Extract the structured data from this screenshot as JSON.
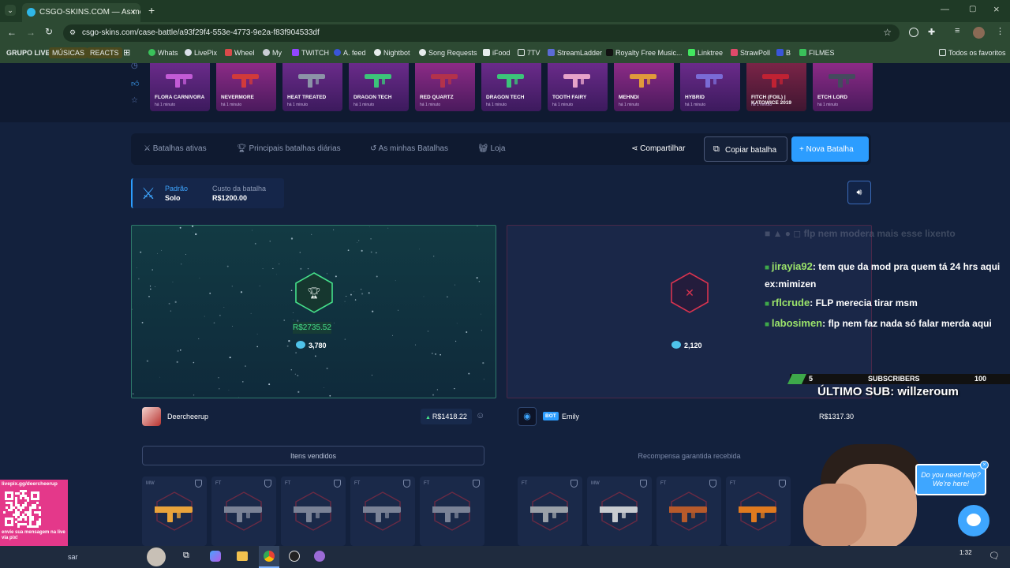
{
  "browser": {
    "tab_title": "CSGO-SKINS.COM — As melho",
    "url": "csgo-skins.com/case-battle/a93f29f4-553e-4773-9e2a-f83f904533df",
    "bookmarks": [
      "GRUPO LIVE",
      "MÚSICAS",
      "REACTS",
      "Whats",
      "LivePix",
      "Wheel",
      "My",
      "TWITCH",
      "A. feed",
      "Nightbot",
      "Song Requests",
      "iFood",
      "7TV",
      "StreamLadder",
      "Royalty Free Music...",
      "Linktree",
      "StrawPoll",
      "B",
      "FILMES"
    ],
    "all_favorites": "Todos os favoritos"
  },
  "drops": [
    {
      "name": "FLORA CARNIVORA",
      "time": "há 1 minuto",
      "color": "#c25bd6"
    },
    {
      "name": "NEVERMORE",
      "time": "há 1 minuto",
      "color": "#d13a3a"
    },
    {
      "name": "HEAT TREATED",
      "time": "há 1 minuto",
      "color": "#8c93a8"
    },
    {
      "name": "DRAGON TECH",
      "time": "há 1 minuto",
      "color": "#3cc47a"
    },
    {
      "name": "RED QUARTZ",
      "time": "há 1 minuto",
      "color": "#b3324b"
    },
    {
      "name": "DRAGON TECH",
      "time": "há 1 minuto",
      "color": "#3cc47a"
    },
    {
      "name": "TOOTH FAIRY",
      "time": "há 1 minuto",
      "color": "#e6a3c9"
    },
    {
      "name": "MEHNDI",
      "time": "há 1 minuto",
      "color": "#e09a3b"
    },
    {
      "name": "HYBRID",
      "time": "há 1 minuto",
      "color": "#7a6bd6"
    },
    {
      "name": "FITCH (FOIL) | KATOWICE 2019",
      "time": "há 1 minuto",
      "color": "#c02233"
    },
    {
      "name": "ETCH LORD",
      "time": "há 1 minuto",
      "color": "#444b5e"
    }
  ],
  "nav": {
    "active_battles": "Batalhas ativas",
    "top_daily": "Principais batalhas diárias",
    "my_battles": "As minhas Batalhas",
    "shop": "Loja",
    "share": "Compartilhar",
    "copy_battle": "Copiar batalha",
    "new_battle": "+ Nova Batalha"
  },
  "battle": {
    "mode": "Padrão",
    "mode_sub": "Solo",
    "cost_label": "Custo da batalha",
    "cost": "R$1200.00"
  },
  "left_arena": {
    "win_value": "R$2735.52",
    "coins": "3,780"
  },
  "right_arena": {
    "coins": "2,120"
  },
  "players": [
    {
      "name": "Deercheerup",
      "value": "R$1418.22",
      "action": "Itens vendidos"
    },
    {
      "badge": "BOT",
      "name": "Emily",
      "value": "R$1317.30",
      "action": "Recompensa garantida recebida"
    }
  ],
  "left_cards": [
    {
      "cond": "MW",
      "color": "#e8a33b"
    },
    {
      "cond": "FT",
      "color": "#7a8296"
    },
    {
      "cond": "FT",
      "color": "#7a8296"
    },
    {
      "cond": "FT",
      "color": "#7a8296"
    },
    {
      "cond": "FT",
      "color": "#7a8296"
    }
  ],
  "right_cards": [
    {
      "cond": "FT",
      "color": "#9aa0a8"
    },
    {
      "cond": "MW",
      "color": "#c8cbd0"
    },
    {
      "cond": "FT",
      "color": "#b75a2b"
    },
    {
      "cond": "FT",
      "color": "#e07a1f"
    }
  ],
  "chat": [
    {
      "user": "jirayia92",
      "msg": ": tem que da mod pra quem tá 24 hrs aqui ex:mimizen",
      "color": "#9be36a"
    },
    {
      "user": "rflcrude",
      "msg": ": FLP merecia tirar msm",
      "color": "#9be36a"
    },
    {
      "user": "labosimen",
      "msg": ": flp nem faz nada só falar merda aqui",
      "color": "#9be36a"
    }
  ],
  "chat_faded": "flp nem moderа mais esse lixento",
  "sub_bar": {
    "current": "5",
    "label": "SUBSCRIBERS",
    "goal": "100",
    "last_sub": "ÚLTIMO SUB: willzeroum"
  },
  "support": {
    "line1": "Do you need help?",
    "line2": "We're here!"
  },
  "livepix": {
    "url": "livepix.gg/deercheerup",
    "caption": "envie sua mensagem na live via pix!"
  },
  "taskbar": {
    "search": "sar",
    "time": "1:32"
  }
}
